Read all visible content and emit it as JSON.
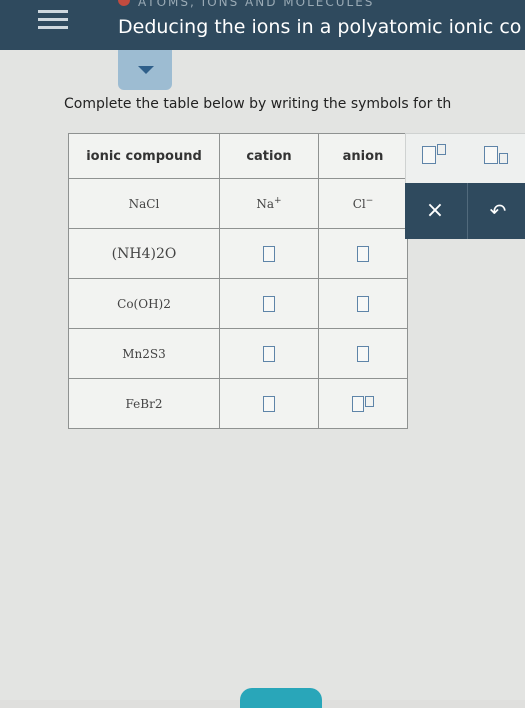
{
  "header": {
    "section": "ATOMS, IONS AND MOLECULES",
    "title": "Deducing the ions in a polyatomic ionic co"
  },
  "instructions": "Complete the table below by writing the symbols for th",
  "table": {
    "headers": [
      "ionic compound",
      "cation",
      "anion"
    ],
    "rows": [
      {
        "compound": "NaCl",
        "cation": "Na",
        "cation_charge": "+",
        "anion": "Cl",
        "anion_charge": "−"
      },
      {
        "compound": "(NH4)2O",
        "cation": "",
        "anion": ""
      },
      {
        "compound": "Co(OH)2",
        "cation": "",
        "anion": ""
      },
      {
        "compound": "Mn2S3",
        "cation": "",
        "anion": ""
      },
      {
        "compound": "FeBr2",
        "cation": "",
        "anion": ""
      }
    ]
  },
  "tools": {
    "superscript_icon": "superscript-box-icon",
    "subscript_icon": "subscript-box-icon",
    "clear_label": "×",
    "undo_label": "↶"
  },
  "colors": {
    "header_bg": "#2f4a5e",
    "input_box": "#5e84a8",
    "accent_teal": "#29a6b9"
  }
}
